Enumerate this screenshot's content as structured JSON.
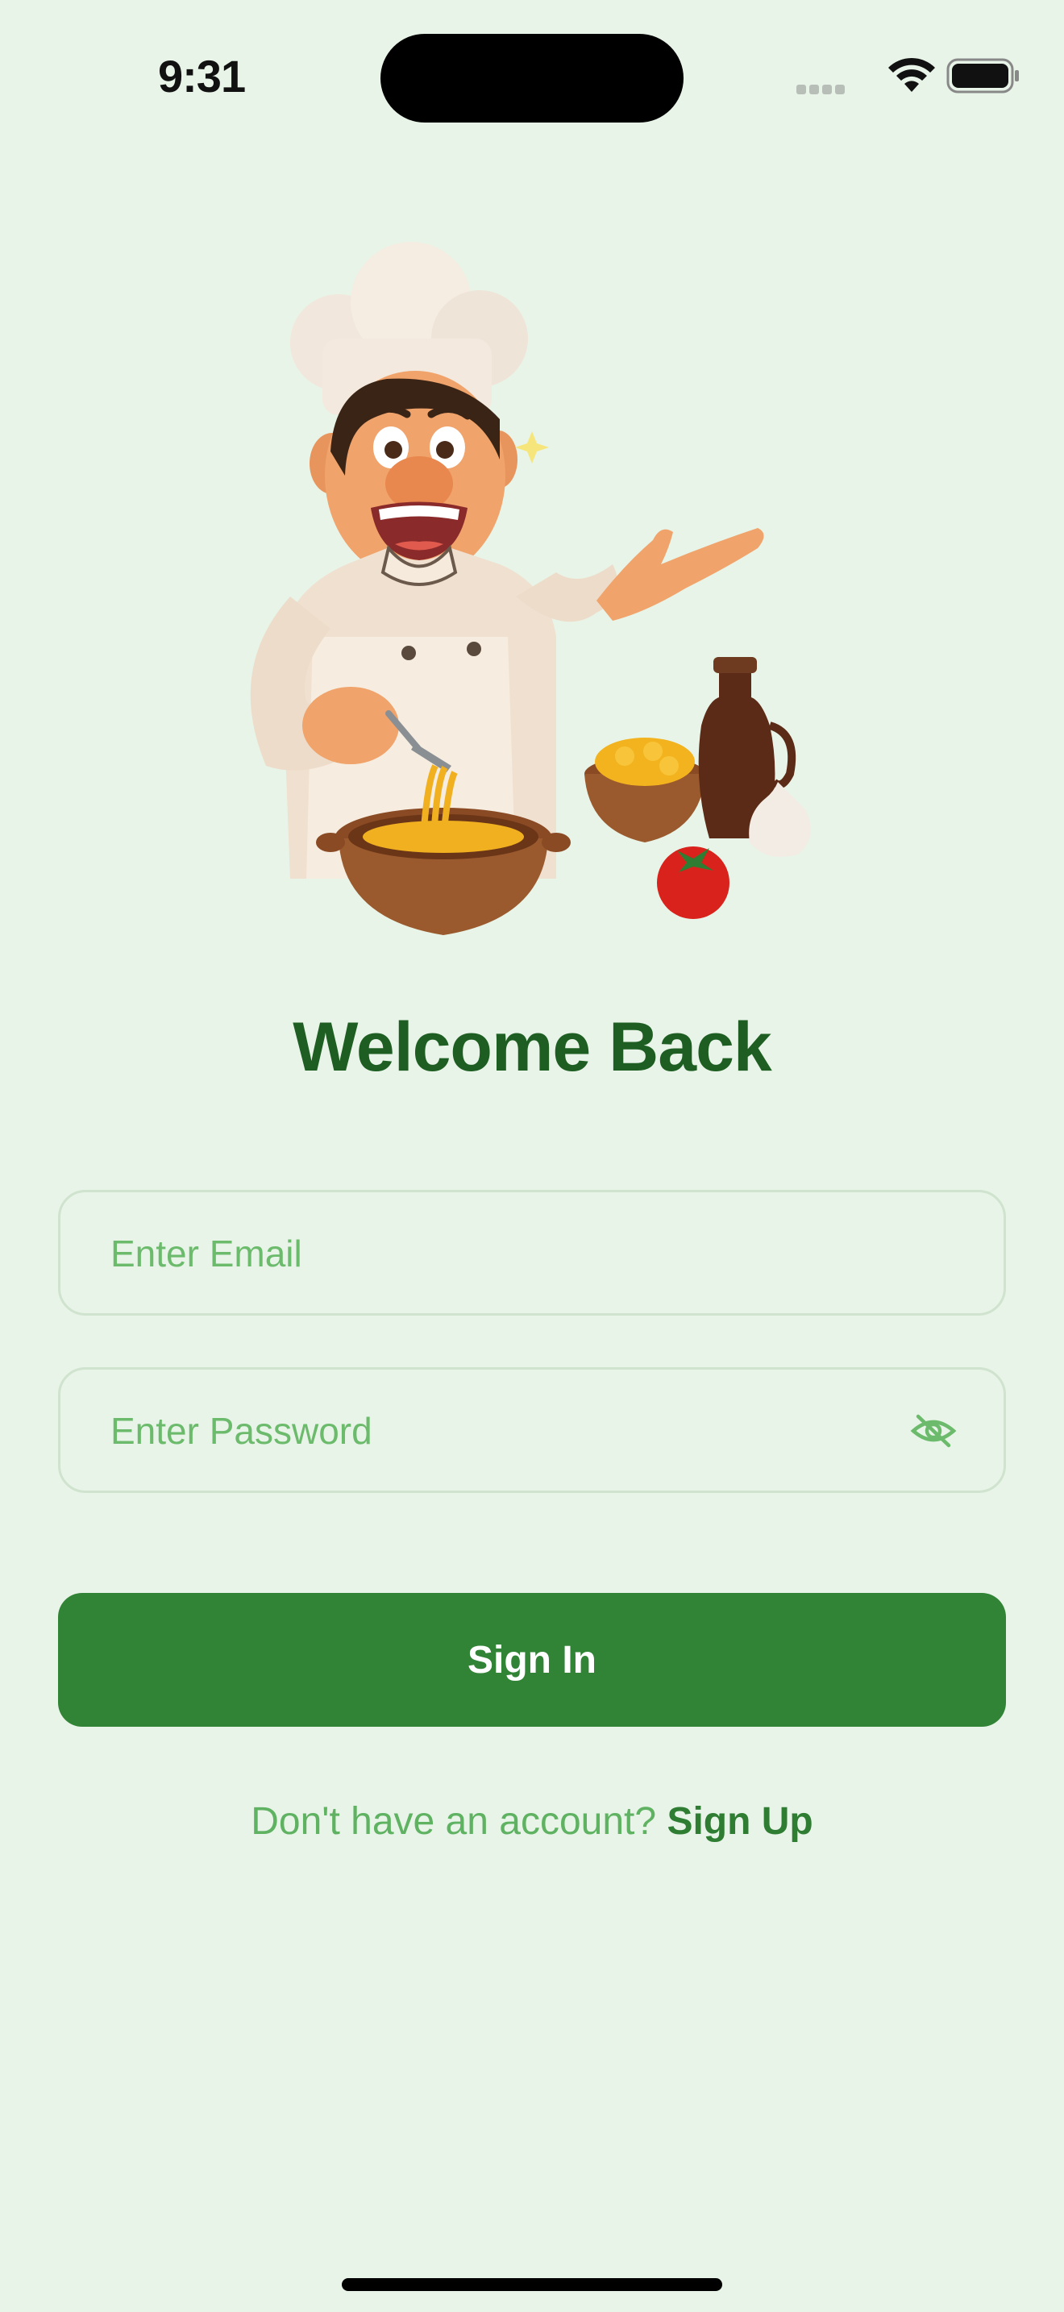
{
  "status_bar": {
    "time": "9:31"
  },
  "auth": {
    "title": "Welcome Back",
    "email_placeholder": "Enter Email",
    "password_placeholder": "Enter Password",
    "signin_label": "Sign In",
    "signup_prompt": "Don't have an account?",
    "signup_link": "Sign Up"
  },
  "icons": {
    "wifi": "wifi-icon",
    "battery": "battery-icon",
    "password_toggle": "eye-slash-icon"
  },
  "colors": {
    "background": "#e8f4e8",
    "title": "#1e5e22",
    "primary_button": "#318336",
    "placeholder": "#6cbb6c",
    "link": "#2e7d32"
  }
}
